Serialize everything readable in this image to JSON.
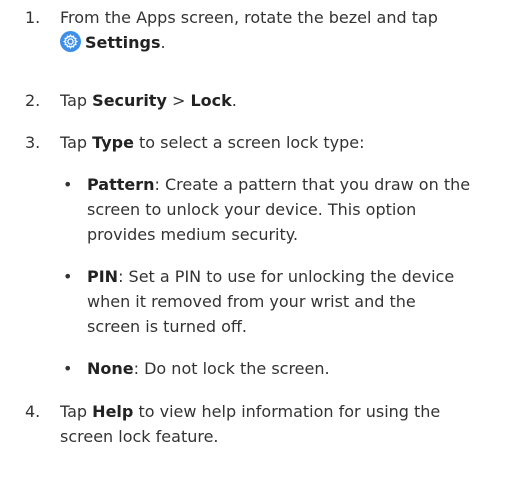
{
  "steps": [
    {
      "number": "1.",
      "line1": "From the Apps screen, rotate the bezel and tap",
      "settings": "Settings",
      "period": "."
    },
    {
      "number": "2.",
      "tap": "Tap ",
      "security": "Security",
      "separator": " > ",
      "lock": "Lock",
      "period": "."
    },
    {
      "number": "3.",
      "tap": "Tap ",
      "type": "Type",
      "rest": " to select a screen lock type:"
    },
    {
      "number": "4.",
      "tap": "Tap ",
      "help": "Help",
      "rest1": " to view help information for using the",
      "line2": "screen lock feature."
    }
  ],
  "options": [
    {
      "bullet": "•",
      "name": "Pattern",
      "line1": ": Create a pattern that you draw on the",
      "line2": "screen to unlock your device. This option",
      "line3": "provides medium security."
    },
    {
      "bullet": "•",
      "name": "PIN",
      "line1": ": Set a PIN to use for unlocking the device",
      "line2": "when it removed from your wrist and the",
      "line3": "screen is turned off."
    },
    {
      "bullet": "•",
      "name": "None",
      "line1": ": Do not lock the screen."
    }
  ],
  "icons": {
    "settings_icon": "gear-icon",
    "settings_icon_color": "#3d8fe8"
  }
}
